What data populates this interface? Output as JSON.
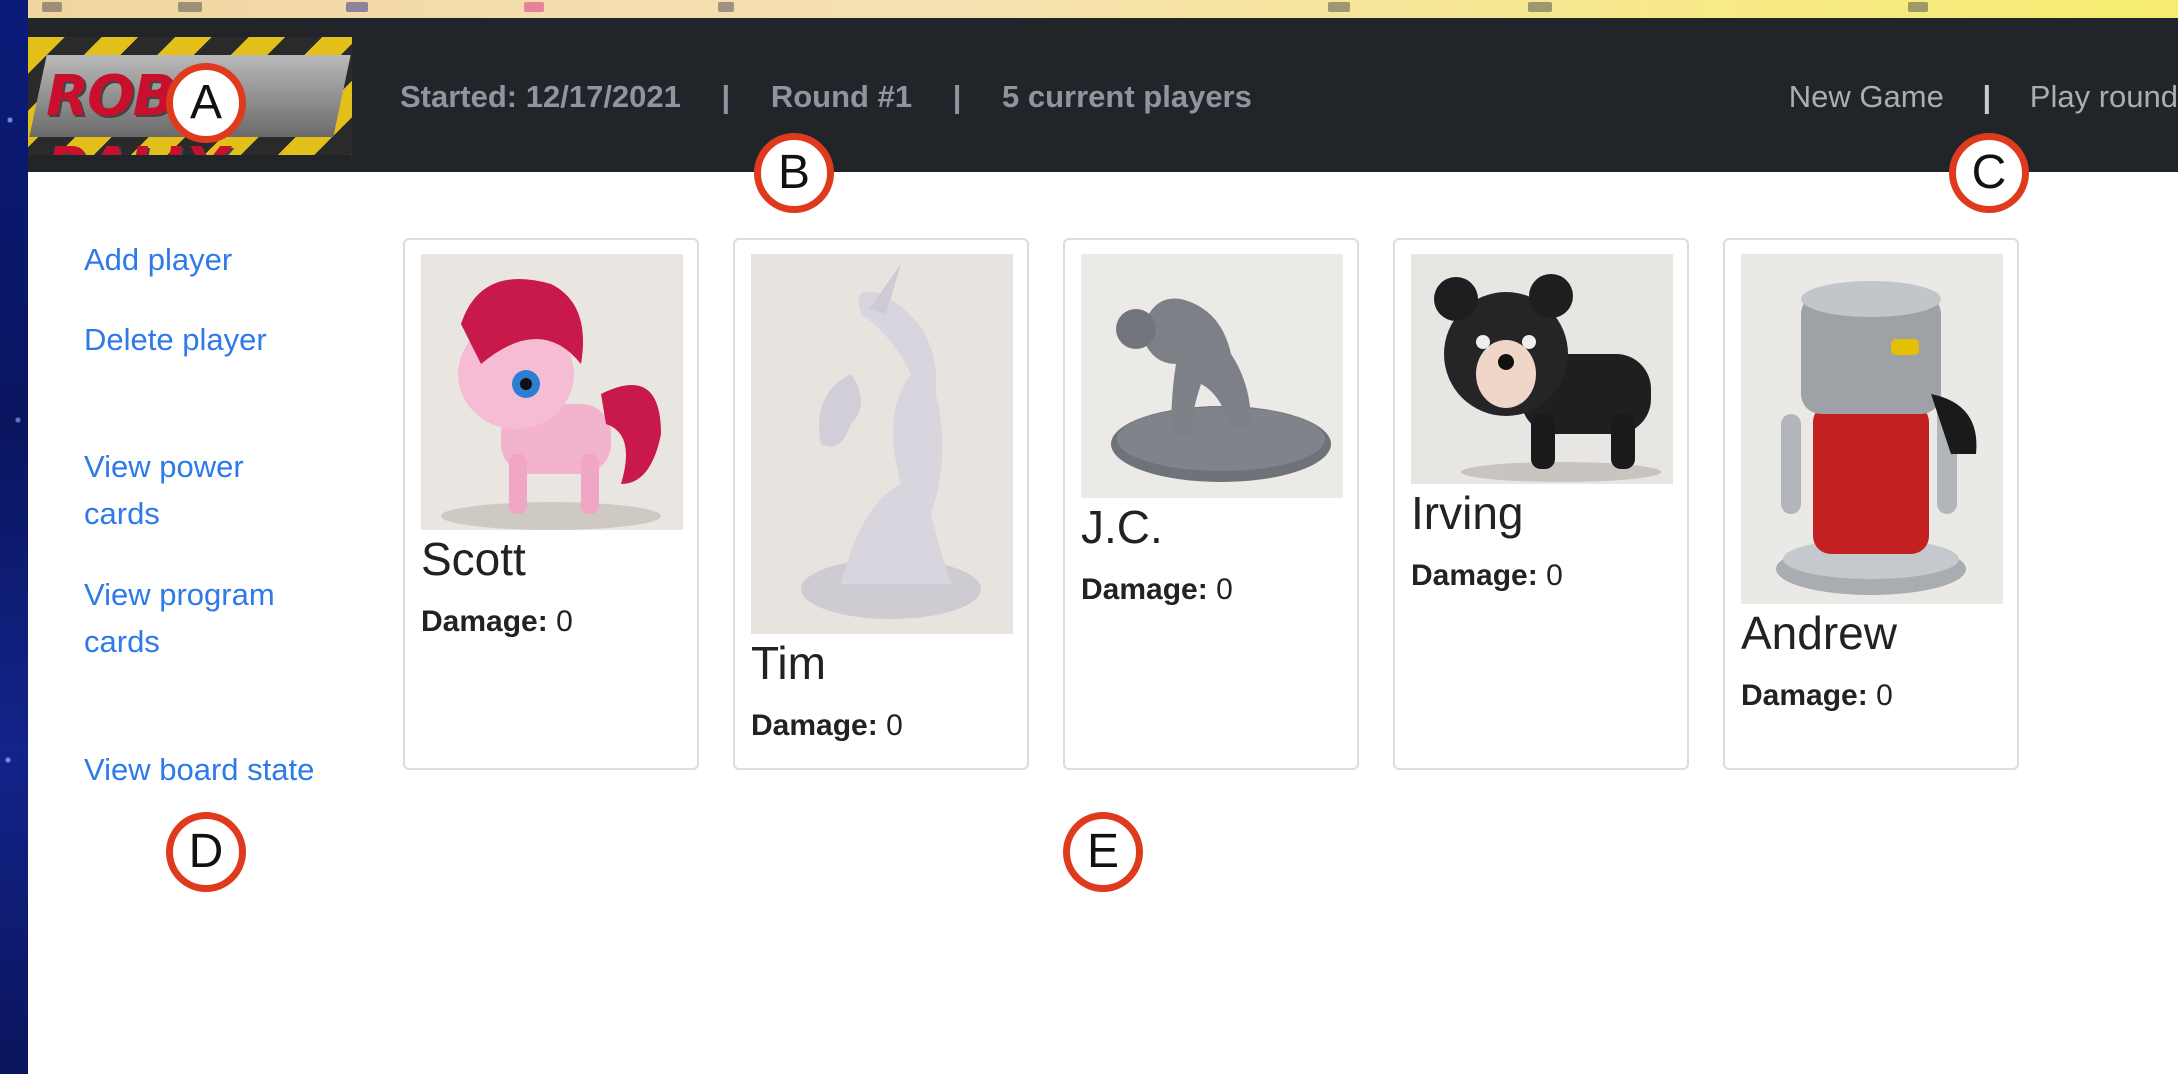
{
  "logo": {
    "text": "ROBO RALLY"
  },
  "navbar": {
    "started": "Started: 12/17/2021",
    "separator": "|",
    "round": "Round #1",
    "players_count": "5 current players",
    "new_game": "New Game",
    "play_round": "Play round"
  },
  "sidebar": {
    "items": [
      {
        "label": "Add player"
      },
      {
        "label": "Delete player"
      },
      {
        "label": "View power cards"
      },
      {
        "label": "View program cards"
      },
      {
        "label": "View board state"
      }
    ]
  },
  "players": [
    {
      "name": "Scott",
      "damage_label": "Damage:",
      "damage": "0",
      "figure": "pink pony"
    },
    {
      "name": "Tim",
      "damage_label": "Damage:",
      "damage": "0",
      "figure": "unicorn"
    },
    {
      "name": "J.C.",
      "damage_label": "Damage:",
      "damage": "0",
      "figure": "crouching figure"
    },
    {
      "name": "Irving",
      "damage_label": "Damage:",
      "damage": "0",
      "figure": "bear"
    },
    {
      "name": "Andrew",
      "damage_label": "Damage:",
      "damage": "0",
      "figure": "robot"
    }
  ],
  "markers": [
    "A",
    "B",
    "C",
    "D",
    "E"
  ],
  "colors": {
    "navbar_bg": "#212529",
    "link": "#2d7ae8",
    "nav_text": "#8e959c",
    "marker_ring": "#e03a1e"
  }
}
